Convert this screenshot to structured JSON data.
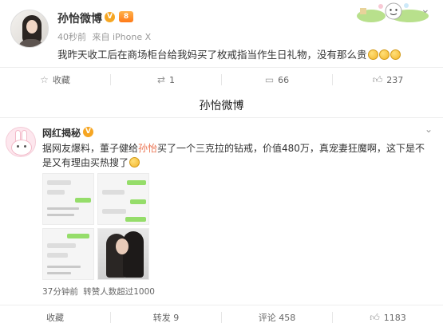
{
  "post1": {
    "author": "孙怡微博",
    "verified_mark": "V",
    "vip_mark": "8",
    "time": "40秒前",
    "source": "来自 iPhone X",
    "text": "我昨天收工后在商场柜台给我妈买了枚戒指当作生日礼物，没有那么贵",
    "actions": {
      "favorite": "收藏",
      "repost": "1",
      "comment": "66",
      "like": "237"
    }
  },
  "caption": "孙怡微博",
  "post2": {
    "author": "网红揭秘",
    "verified_mark": "V",
    "text_prefix": "据网友爆料，董子健给",
    "text_highlight": "孙怡",
    "text_suffix": "买了一个三克拉的钻戒，价值480万，真宠妻狂魔啊，这下是不是又有理由买热搜了",
    "time": "37分钟前",
    "likes_info": "转赞人数超过1000",
    "actions": {
      "favorite": "收藏",
      "repost": "转发 9",
      "comment": "评论 458",
      "like": "1183"
    }
  }
}
